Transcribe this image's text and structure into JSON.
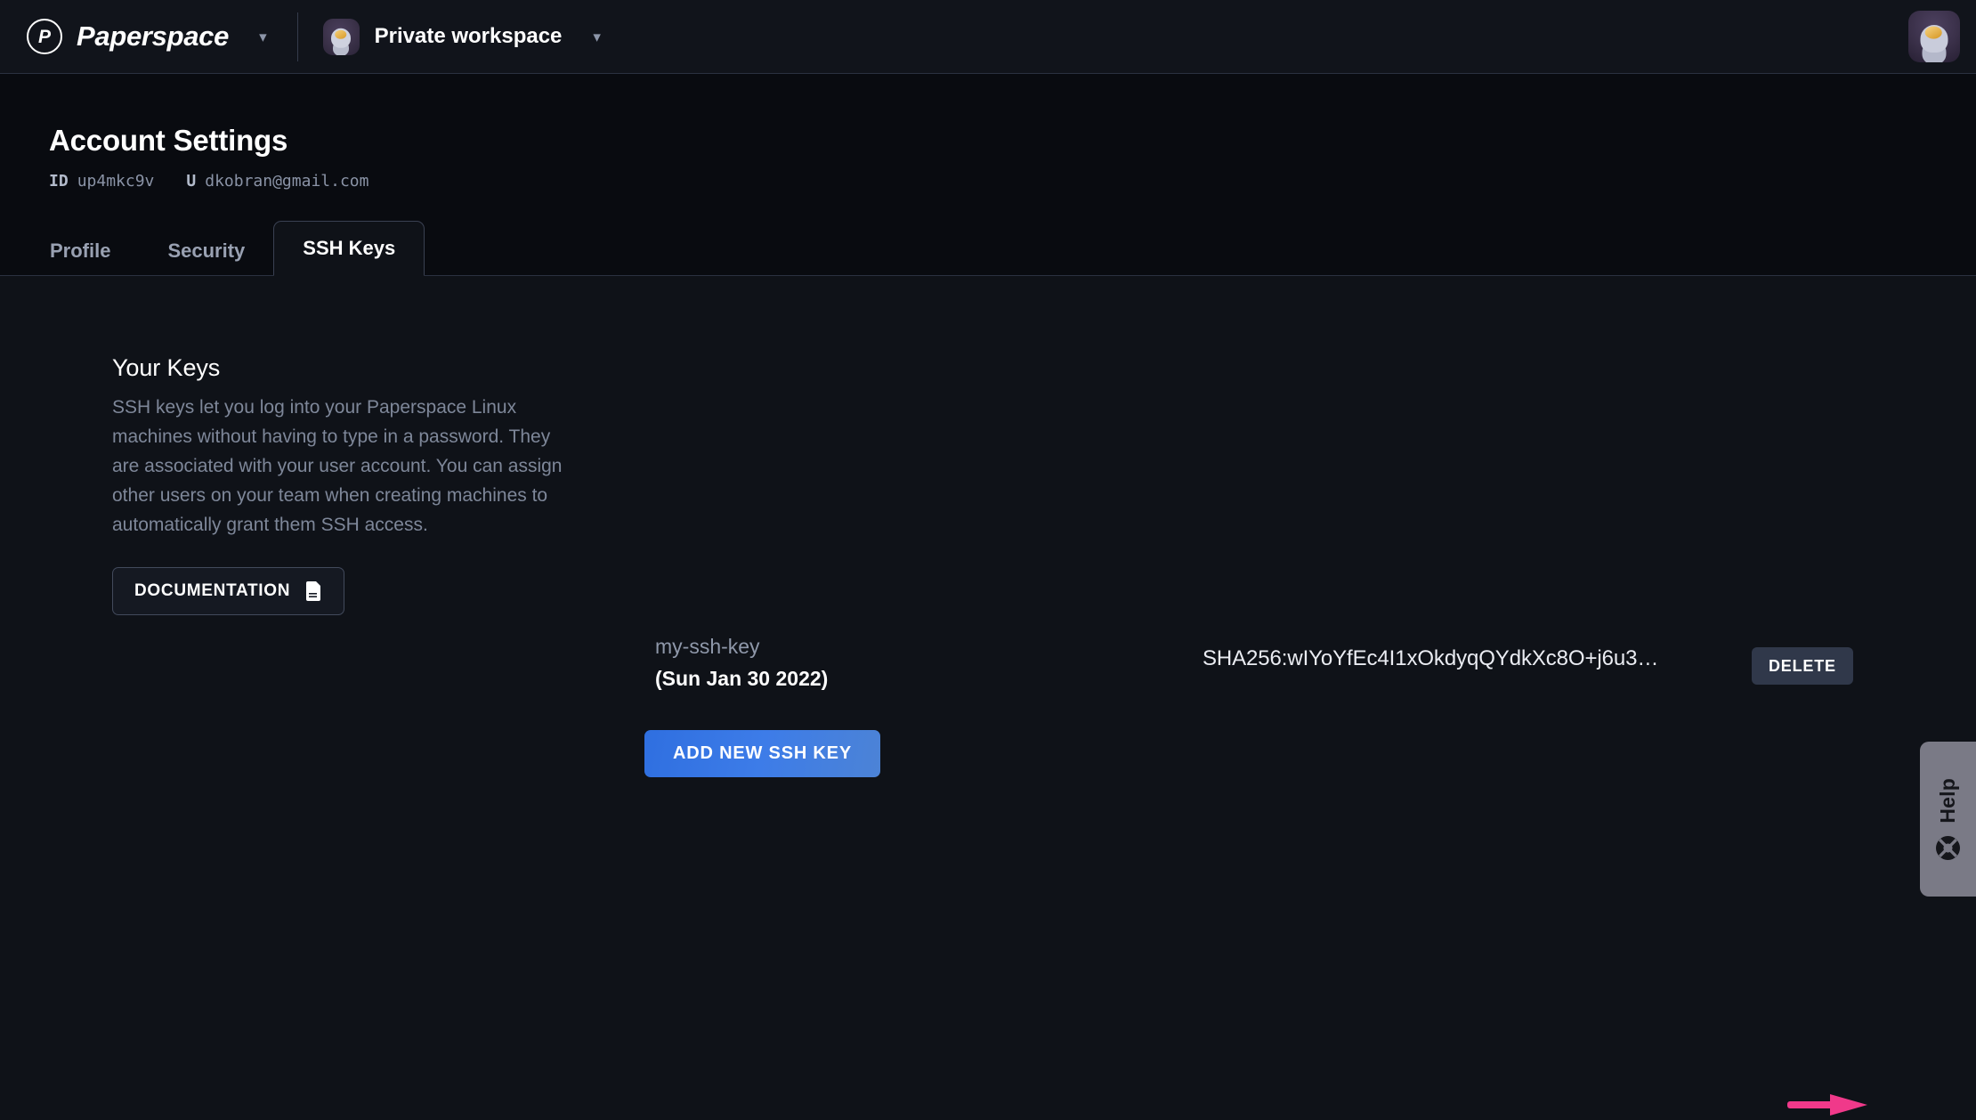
{
  "topbar": {
    "brand_mark": "P",
    "brand_name": "Paperspace",
    "brand_chevron": "chevron-down-icon",
    "workspace_name": "Private workspace",
    "workspace_chevron": "chevron-down-icon",
    "avatar_alt": "astronaut-avatar"
  },
  "page": {
    "title": "Account Settings",
    "id_label": "ID",
    "id_value": "up4mkc9v",
    "user_label": "U",
    "user_value": "dkobran@gmail.com"
  },
  "tabs": [
    {
      "label": "Profile",
      "active": false
    },
    {
      "label": "Security",
      "active": false
    },
    {
      "label": "SSH Keys",
      "active": true
    }
  ],
  "info": {
    "heading": "Your Keys",
    "body": "SSH keys let you log into your Paperspace Linux machines without having to type in a password. They are associated with your user account. You can assign other users on your team when creating machines to automatically grant them SSH access.",
    "documentation_label": "DOCUMENTATION",
    "documentation_icon": "document-icon"
  },
  "keys": {
    "add_button_label": "ADD NEW SSH KEY",
    "rows": [
      {
        "name": "my-ssh-key",
        "date": "(Sun Jan 30 2022)",
        "fingerprint": "SHA256:wIYoYfEc4I1xOkdyqQYdkXc8O+j6u3…",
        "delete_label": "DELETE"
      }
    ]
  },
  "help": {
    "label": "Help",
    "icon": "lifebuoy-icon"
  },
  "annotation": {
    "type": "arrow-right",
    "color": "#f0398a"
  },
  "colors": {
    "page_background": "#0f1218",
    "header_background": "#090b10",
    "topbar_background": "#11141b",
    "accent_blue": "#3d7ce8",
    "muted_text": "#7e8799",
    "delete_button": "#30384a",
    "help_tab": "#7a7a86"
  }
}
